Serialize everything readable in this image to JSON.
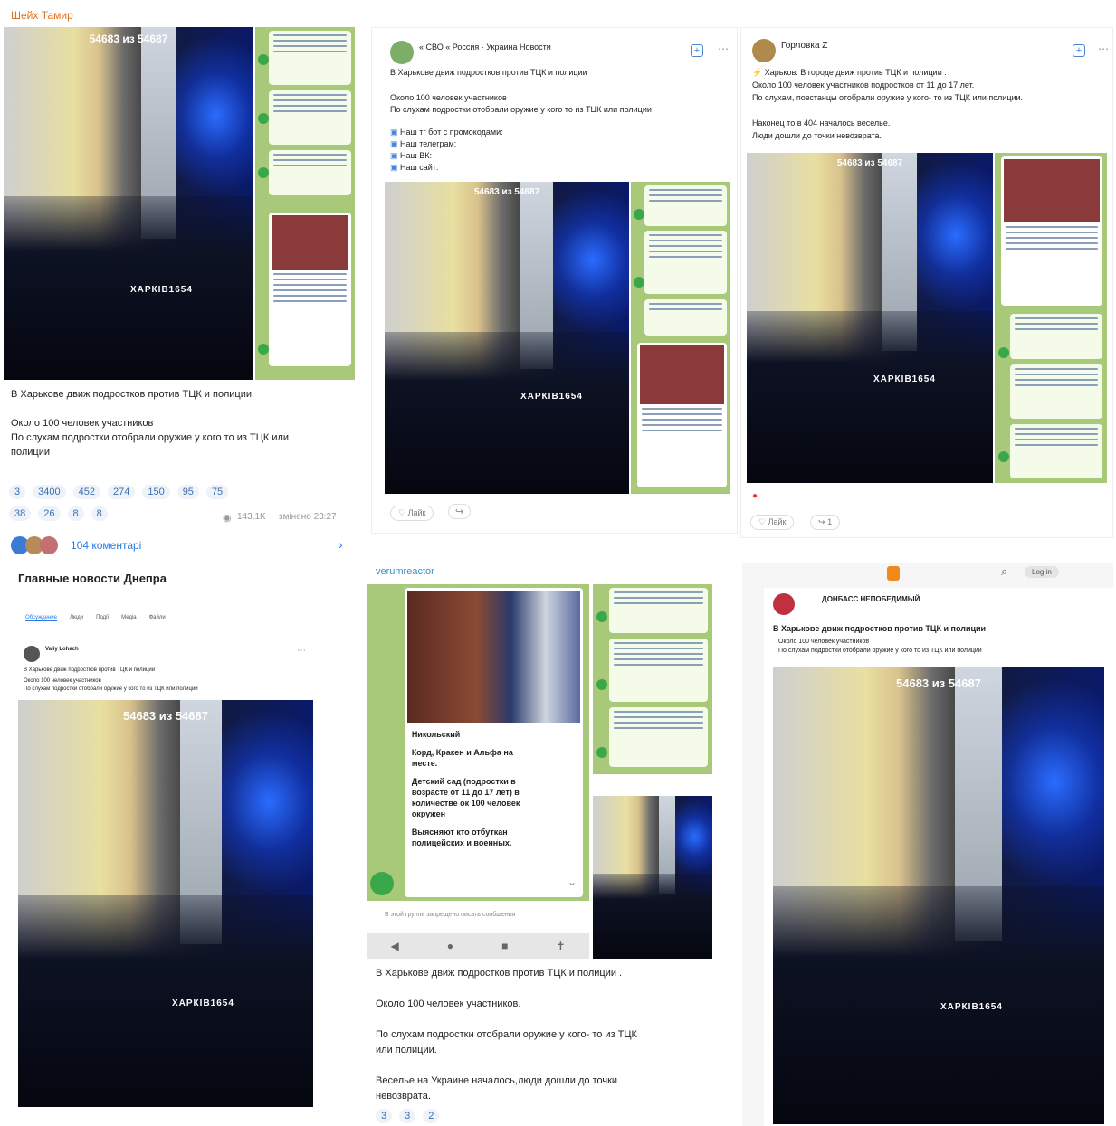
{
  "p1": {
    "author": "Шейх Тамир",
    "counter": "54683 из 54687",
    "watermark": "ХАРКІВ1654",
    "line1": "В Харькове движ подростков против ТЦК и полиции",
    "line2": "Около 100 человек участников",
    "line3": "По слухам подростки отобрали оружие у кого то из ТЦК или",
    "line4": "полиции",
    "reactions_row1": [
      "3",
      "3400",
      "452",
      "274",
      "150",
      "95",
      "75"
    ],
    "reactions_row2": [
      "38",
      "26",
      "8",
      "8"
    ],
    "views": "143,1K",
    "edited": "змінено 23:27",
    "comments": "104 коментарі"
  },
  "p2": {
    "channel": "« СВО « Россия · Украина Новости",
    "headline": "В Харькове движ подростков против ТЦК и полиции",
    "line1": "Около 100 человек участников",
    "line2": "По слухам подростки отобрали оружие у кого то из ТЦК или полиции",
    "links": [
      "Наш тг бот с промокодами:",
      "Наш телеграм:",
      "Наш ВК:",
      "Наш сайт:"
    ],
    "counter": "54683 из 54687",
    "watermark": "ХАРКІВ1654",
    "like": "Лайк"
  },
  "p3": {
    "author": "Горловка Z",
    "line1": "Харьков. В городе движ против ТЦК и полиции .",
    "line2": "Около 100 человек участников подростков от 11 до 17 лет.",
    "line3": "По слухам, повстанцы отобрали оружие у кого- то из ТЦК или полиции.",
    "line4": "Наконец то в 404 началось веселье.",
    "line5": "Люди дошли до точки невозврата.",
    "counter": "54683 из 54687",
    "watermark": "ХАРКІВ1654",
    "like": "Лайк",
    "share_count": "1"
  },
  "p4": {
    "title": "Главные новости Днепра",
    "tabs": [
      "Обсуждение",
      "Люди",
      "Події",
      "Медіа",
      "Файли"
    ],
    "author": "Valiy Lohach",
    "line1": "В Харькове движ подростков против ТЦК и полиции",
    "line2": "Около 100 человек участников",
    "line3": "По слухам подростки отобрали оружие у кого то из ТЦК или полиции",
    "counter": "54683 из 54687",
    "watermark": "ХАРКІВ1654"
  },
  "p5": {
    "channel": "verumreactor",
    "chat_lines": [
      "Никольский",
      "Корд, Кракен и Альфа на",
      "месте.",
      "Детский сад (подростки в",
      "возрасте от 11 до 17 лет) в",
      "количестве ок 100 человек",
      "окружен",
      "Выясняют кто отбуткан",
      "полицейских и военных."
    ],
    "footer": "В этой группе запрещено писать сообщения",
    "line1": "В Харькове движ подростков против ТЦК и полиции .",
    "line2": "Около 100 человек участников.",
    "line3": "По слухам подростки отобрали оружие у кого- то из ТЦК",
    "line4": "или полиции.",
    "line5": "Веселье на Украине началось,люди дошли до точки",
    "line6": "невозврата.",
    "reactions": [
      "3",
      "3",
      "2"
    ]
  },
  "p6": {
    "login": "Log in",
    "author": "ДОНБАСС НЕПОБЕДИМЫЙ",
    "headline": "В Харькове движ подростков против ТЦК и полиции",
    "line1": "Около 100 человек участников",
    "line2": "По слухам подростки отобрали оружие у кого то из ТЦК или полиции",
    "counter": "54683 из 54687",
    "watermark": "ХАРКІВ1654"
  },
  "colors": {
    "accent": "#e07020",
    "link": "#2a7ae2",
    "chat_bg": "#a8c97a"
  }
}
